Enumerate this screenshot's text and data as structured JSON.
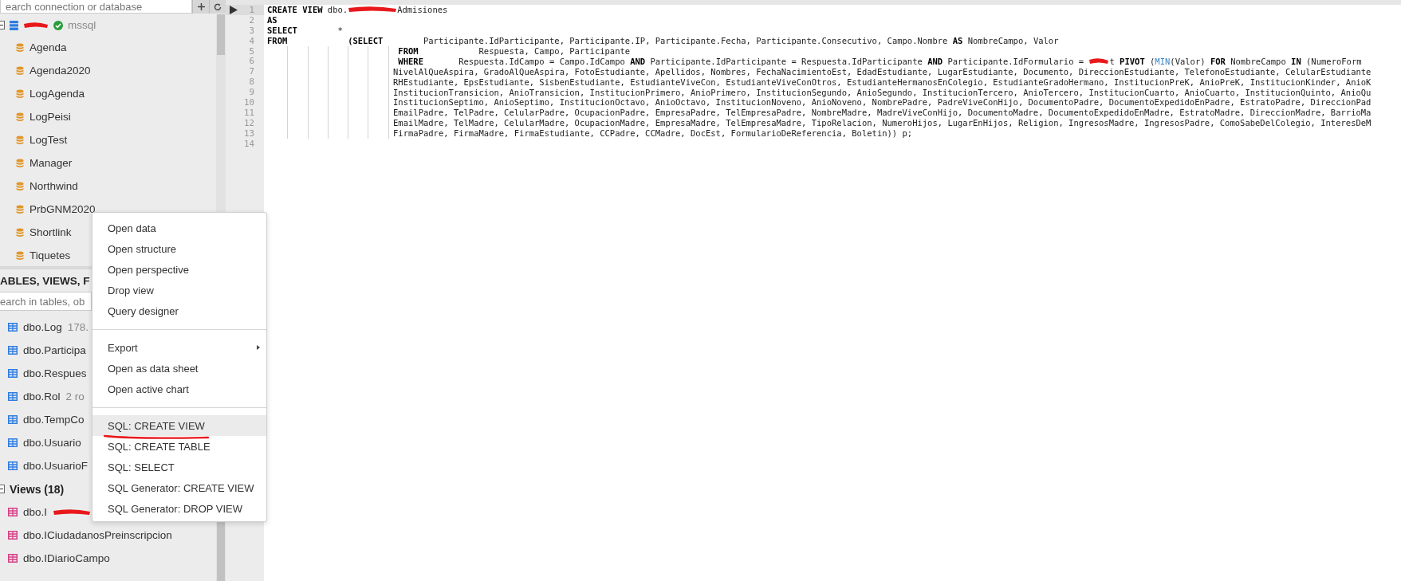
{
  "connections_panel": {
    "search_placeholder": "earch connection or database",
    "connection": {
      "expanded": true,
      "redacted": true,
      "connected": true,
      "driver": "mssql"
    },
    "databases": [
      "Agenda",
      "Agenda2020",
      "LogAgenda",
      "LogPeisi",
      "LogTest",
      "Manager",
      "Northwind",
      "PrbGNM2020",
      "Shortlink",
      "Tiquetes"
    ]
  },
  "objects_panel": {
    "title": "ABLES, VIEWS, F",
    "search_placeholder": "earch in tables, ob",
    "tables": [
      {
        "name": "dbo.Log",
        "info": "178."
      },
      {
        "name": "dbo.Participa"
      },
      {
        "name": "dbo.Respues"
      },
      {
        "name": "dbo.Rol",
        "info": "2 ro"
      },
      {
        "name": "dbo.TempCo"
      },
      {
        "name": "dbo.Usuario"
      },
      {
        "name": "dbo.UsuarioF"
      }
    ],
    "views_group": {
      "label": "Views (18)",
      "expanded": true
    },
    "views": [
      {
        "name": "dbo.I",
        "redacted": true
      },
      {
        "name": "dbo.ICiudadanosPreinscripcion",
        "redacted": false
      },
      {
        "name": "dbo.IDiarioCampo",
        "redacted": false
      }
    ]
  },
  "context_menu": {
    "groups": [
      [
        {
          "label": "Open data",
          "selected": false,
          "submenu": false,
          "annotated": false
        },
        {
          "label": "Open structure",
          "selected": false,
          "submenu": false,
          "annotated": false
        },
        {
          "label": "Open perspective",
          "selected": false,
          "submenu": false,
          "annotated": false
        },
        {
          "label": "Drop view",
          "selected": false,
          "submenu": false,
          "annotated": false
        },
        {
          "label": "Query designer",
          "selected": false,
          "submenu": false,
          "annotated": false
        }
      ],
      [
        {
          "label": "Export",
          "selected": false,
          "submenu": true,
          "annotated": false
        },
        {
          "label": "Open as data sheet",
          "selected": false,
          "submenu": false,
          "annotated": false
        },
        {
          "label": "Open active chart",
          "selected": false,
          "submenu": false,
          "annotated": false
        }
      ],
      [
        {
          "label": "SQL: CREATE VIEW",
          "selected": true,
          "submenu": false,
          "annotated": true
        },
        {
          "label": "SQL: CREATE TABLE",
          "selected": false,
          "submenu": false,
          "annotated": false
        },
        {
          "label": "SQL: SELECT",
          "selected": false,
          "submenu": false,
          "annotated": false
        },
        {
          "label": "SQL Generator: CREATE VIEW",
          "selected": false,
          "submenu": false,
          "annotated": false
        },
        {
          "label": "SQL Generator: DROP VIEW",
          "selected": false,
          "submenu": false,
          "annotated": false
        }
      ]
    ]
  },
  "editor": {
    "lines": [
      {
        "number": "1",
        "current": true,
        "segments": [
          {
            "kind": "keyword",
            "text": "CREATE VIEW"
          },
          {
            "kind": "plain",
            "text": " dbo."
          },
          {
            "kind": "redacted"
          },
          {
            "kind": "plain",
            "text": "Admisiones"
          }
        ]
      },
      {
        "number": "2",
        "current": false,
        "segments": [
          {
            "kind": "keyword",
            "text": "AS"
          }
        ]
      },
      {
        "number": "3",
        "current": false,
        "segments": [
          {
            "kind": "keyword",
            "text": "SELECT"
          },
          {
            "kind": "plain",
            "text": "        *"
          }
        ]
      },
      {
        "number": "4",
        "current": false,
        "segments": [
          {
            "kind": "keyword",
            "text": "FROM            (SELECT"
          },
          {
            "kind": "plain",
            "text": "        Participante.IdParticipante, Participante.IP, Participante.Fecha, Participante.Consecutivo, Campo.Nombre "
          },
          {
            "kind": "keyword",
            "text": "AS"
          },
          {
            "kind": "plain",
            "text": " NombreCampo, Valor"
          }
        ]
      },
      {
        "number": "5",
        "current": false,
        "segments": [
          {
            "kind": "keyword",
            "text": "                          FROM"
          },
          {
            "kind": "plain",
            "text": "            Respuesta, Campo, Participante"
          }
        ]
      },
      {
        "number": "6",
        "current": false,
        "segments": [
          {
            "kind": "keyword",
            "text": "                          WHERE"
          },
          {
            "kind": "plain",
            "text": "       Respuesta.IdCampo = Campo.IdCampo "
          },
          {
            "kind": "keyword",
            "text": "AND"
          },
          {
            "kind": "plain",
            "text": " Participante.IdParticipante = Respuesta.IdParticipante "
          },
          {
            "kind": "keyword",
            "text": "AND"
          },
          {
            "kind": "plain",
            "text": " Participante.IdFormulario = "
          },
          {
            "kind": "redacted_short"
          },
          {
            "kind": "plain",
            "text": "t "
          },
          {
            "kind": "keyword",
            "text": "PIVOT"
          },
          {
            "kind": "plain",
            "text": " ("
          },
          {
            "kind": "function",
            "text": "MIN"
          },
          {
            "kind": "plain",
            "text": "(Valor) "
          },
          {
            "kind": "keyword",
            "text": "FOR"
          },
          {
            "kind": "plain",
            "text": " NombreCampo "
          },
          {
            "kind": "keyword",
            "text": "IN"
          },
          {
            "kind": "plain",
            "text": " (NumeroForm"
          }
        ]
      },
      {
        "number": "7",
        "current": false,
        "segments": [
          {
            "kind": "plain",
            "text": "                         NivelAlQueAspira, GradoAlQueAspira, FotoEstudiante, Apellidos, Nombres, FechaNacimientoEst, EdadEstudiante, LugarEstudiante, Documento, DireccionEstudiante, TelefonoEstudiante, CelularEstudiante"
          }
        ]
      },
      {
        "number": "8",
        "current": false,
        "segments": [
          {
            "kind": "plain",
            "text": "                         RHEstudiante, EpsEstudiante, SisbenEstudiante, EstudianteViveCon, EstudianteViveConOtros, EstudianteHermanosEnColegio, EstudianteGradoHermano, InstitucionPreK, AnioPreK, InstitucionKinder, AnioK"
          }
        ]
      },
      {
        "number": "9",
        "current": false,
        "segments": [
          {
            "kind": "plain",
            "text": "                         InstitucionTransicion, AnioTransicion, InstitucionPrimero, AnioPrimero, InstitucionSegundo, AnioSegundo, InstitucionTercero, AnioTercero, InstitucionCuarto, AnioCuarto, InstitucionQuinto, AnioQu"
          }
        ]
      },
      {
        "number": "10",
        "current": false,
        "segments": [
          {
            "kind": "plain",
            "text": "                         InstitucionSeptimo, AnioSeptimo, InstitucionOctavo, AnioOctavo, InstitucionNoveno, AnioNoveno, NombrePadre, PadreViveConHijo, DocumentoPadre, DocumentoExpedidoEnPadre, EstratoPadre, DireccionPad"
          }
        ]
      },
      {
        "number": "11",
        "current": false,
        "segments": [
          {
            "kind": "plain",
            "text": "                         EmailPadre, TelPadre, CelularPadre, OcupacionPadre, EmpresaPadre, TelEmpresaPadre, NombreMadre, MadreViveConHijo, DocumentoMadre, DocumentoExpedidoEnMadre, EstratoMadre, DireccionMadre, BarrioMa"
          }
        ]
      },
      {
        "number": "12",
        "current": false,
        "segments": [
          {
            "kind": "plain",
            "text": "                         EmailMadre, TelMadre, CelularMadre, OcupacionMadre, EmpresaMadre, TelEmpresaMadre, TipoRelacion, NumeroHijos, LugarEnHijos, Religion, IngresosMadre, IngresosPadre, ComoSabeDelColegio, InteresDeM"
          }
        ]
      },
      {
        "number": "13",
        "current": false,
        "segments": [
          {
            "kind": "plain",
            "text": "                         FirmaPadre, FirmaMadre, FirmaEstudiante, CCPadre, CCMadre, DocEst, FormularioDeReferencia, Boletin)) p;"
          }
        ]
      },
      {
        "number": "14",
        "current": false
      }
    ]
  }
}
